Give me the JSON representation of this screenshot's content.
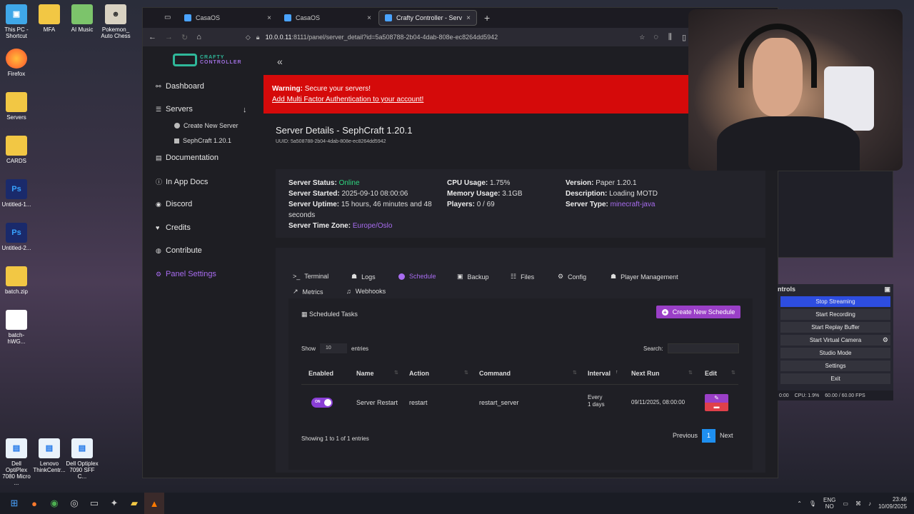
{
  "desktop": {
    "icons": [
      {
        "label": "This PC - Shortcut",
        "glyph": "▣"
      },
      {
        "label": "MFA",
        "glyph": ""
      },
      {
        "label": "AI Music",
        "glyph": ""
      },
      {
        "label": "Pokemon_ Auto Chess",
        "glyph": "☻"
      },
      {
        "label": "Firefox",
        "glyph": ""
      },
      {
        "label": "Servers",
        "glyph": ""
      },
      {
        "label": "CARDS",
        "glyph": ""
      },
      {
        "label": "Untitled-1...",
        "glyph": "Ps"
      },
      {
        "label": "Untitled-2...",
        "glyph": "Ps"
      },
      {
        "label": "batch.zip",
        "glyph": ""
      },
      {
        "label": "batch-hWG...",
        "glyph": ""
      },
      {
        "label": "Dell OptiPlex 7080 Micro ...",
        "glyph": "▤"
      },
      {
        "label": "Lenovo ThinkCentr...",
        "glyph": "▤"
      },
      {
        "label": "Dell Optiplex 7090 SFF C...",
        "glyph": "▤"
      }
    ]
  },
  "browser": {
    "tabs": [
      {
        "label": "CasaOS",
        "close": "×"
      },
      {
        "label": "CasaOS",
        "close": "×"
      },
      {
        "label": "Crafty Controller - Server Detail",
        "close": "×"
      }
    ],
    "new_tab": "+",
    "url_host": "10.0.0.11",
    "url_rest": ":8111/panel/server_detail?id=5a508788-2b04-4dab-808e-ec8264dd5942"
  },
  "logo": {
    "line1": "CRAFTY",
    "line2": "CONTROLLER"
  },
  "sidebar": {
    "dashboard": "Dashboard",
    "servers": "Servers",
    "create_new_server": "Create New Server",
    "server_item": "SephCraft 1.20.1",
    "documentation": "Documentation",
    "in_app_docs": "In App Docs",
    "discord": "Discord",
    "credits": "Credits",
    "contribute": "Contribute",
    "panel_settings": "Panel Settings"
  },
  "warning": {
    "bold": "Warning:",
    "text": " Secure your servers!",
    "link": "Add Multi Factor Authentication to your account!"
  },
  "server": {
    "title": "Server Details - SephCraft 1.20.1",
    "uuid": "UUID: 5a508788-2b04-4dab-808e-ec8264dd5942",
    "status_label": "Server Status:",
    "status_value": "Online",
    "started_label": "Server Started:",
    "started_value": "2025-09-10 08:00:06",
    "uptime_label": "Server Uptime:",
    "uptime_value": "15 hours, 46 minutes and 48 seconds",
    "tz_label": "Server Time Zone:",
    "tz_value": "Europe/Oslo",
    "cpu_label": "CPU Usage:",
    "cpu_value": "1.75%",
    "mem_label": "Memory Usage:",
    "mem_value": "3.1GB",
    "players_label": "Players:",
    "players_value": "0 / 69",
    "version_label": "Version:",
    "version_value": "Paper 1.20.1",
    "desc_label": "Description:",
    "desc_value": "Loading MOTD",
    "type_label": "Server Type:",
    "type_value": "minecraft-java"
  },
  "server_tabs": {
    "terminal": "Terminal",
    "logs": "Logs",
    "schedule": "Schedule",
    "backup": "Backup",
    "files": "Files",
    "config": "Config",
    "player_management": "Player Management",
    "metrics": "Metrics",
    "webhooks": "Webhooks"
  },
  "schedule": {
    "title": "Scheduled Tasks",
    "create_button": "Create New Schedule",
    "show_label": "Show",
    "show_value": "10",
    "entries_label": "entries",
    "search_label": "Search:",
    "columns": [
      "Enabled",
      "Name",
      "Action",
      "Command",
      "Interval",
      "Next Run",
      "Edit"
    ],
    "row": {
      "toggle": "ON",
      "name": "Server Restart",
      "action": "restart",
      "command": "restart_server",
      "interval_line1": "Every",
      "interval_line2": "1 days",
      "next_run": "09/11/2025, 08:00:00"
    },
    "showing": "Showing 1 to 1 of 1 entries",
    "prev": "Previous",
    "page": "1",
    "next": "Next"
  },
  "obs": {
    "header": "ntrols",
    "buttons": [
      "Stop Streaming",
      "Start Recording",
      "Start Replay Buffer",
      "Start Virtual Camera",
      "Studio Mode",
      "Settings",
      "Exit"
    ],
    "status_time": "0:00",
    "status_cpu": "CPU: 1.9%",
    "status_fps": "60.00 / 60.00 FPS"
  },
  "taskbar": {
    "lang1": "ENG",
    "lang2": "NO",
    "time": "23:46",
    "date": "10/09/2025"
  }
}
